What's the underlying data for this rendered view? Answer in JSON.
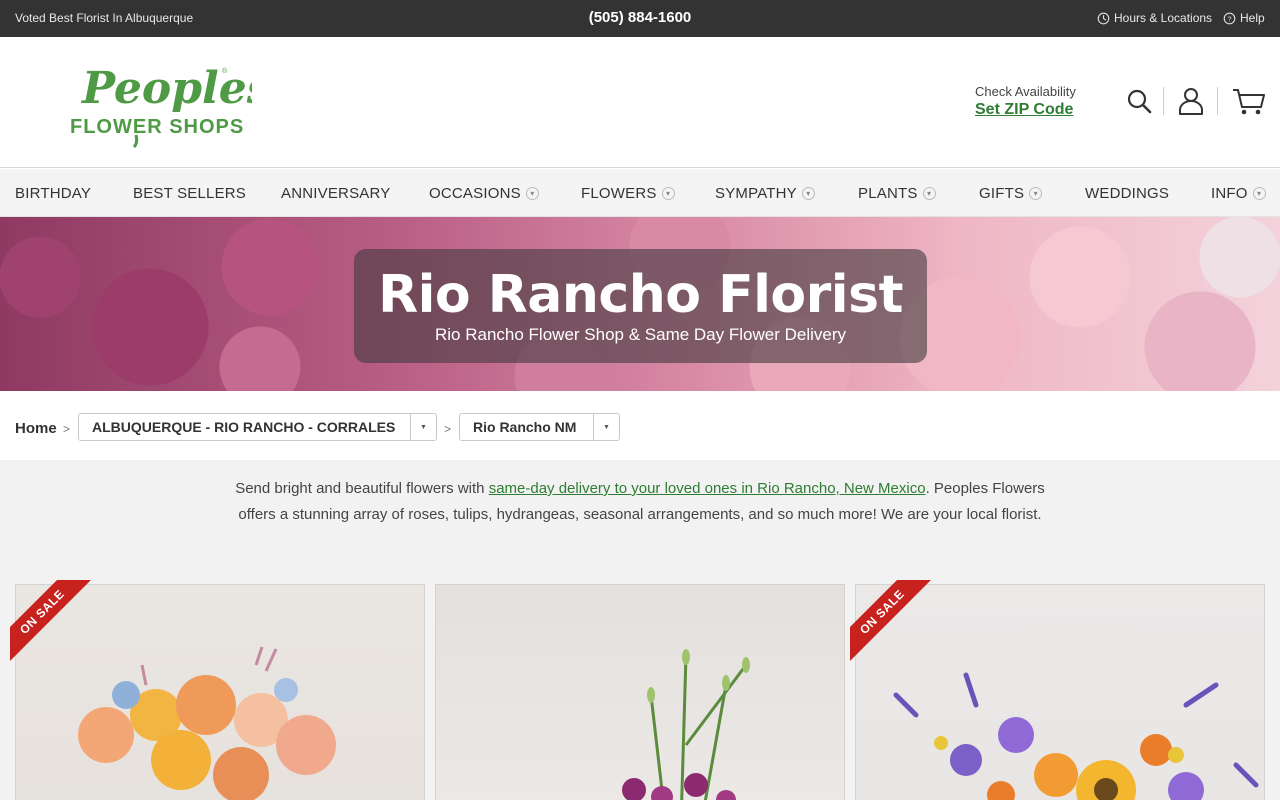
{
  "topbar": {
    "tagline": "Voted Best Florist In Albuquerque",
    "phone": "(505) 884-1600",
    "hours_label": "Hours & Locations",
    "help_label": "Help"
  },
  "header": {
    "logo_text_top": "Peoples",
    "logo_text_bottom": "FLOWER SHOPS",
    "zip_label": "Check Availability",
    "zip_link": "Set ZIP Code"
  },
  "nav": {
    "items": [
      {
        "label": "BIRTHDAY"
      },
      {
        "label": "BEST SELLERS"
      },
      {
        "label": "ANNIVERSARY"
      },
      {
        "label": "OCCASIONS"
      },
      {
        "label": "FLOWERS"
      },
      {
        "label": "SYMPATHY"
      },
      {
        "label": "PLANTS"
      },
      {
        "label": "GIFTS"
      },
      {
        "label": "WEDDINGS"
      },
      {
        "label": "INFO"
      }
    ]
  },
  "hero": {
    "title": "Rio Rancho Florist",
    "subtitle": "Rio Rancho Flower Shop & Same Day Flower Delivery"
  },
  "breadcrumb": {
    "home": "Home",
    "separator": ">",
    "region": "ALBUQUERQUE - RIO RANCHO - CORRALES",
    "city": "Rio Rancho NM"
  },
  "intro": {
    "before_link": "Send bright and beautiful flowers with ",
    "link": "same-day delivery to your loved ones in Rio Rancho, New Mexico",
    "after_link": ". Peoples Flowers offers a stunning array of roses, tulips, hydrangeas, seasonal arrangements, and so much more! We are your local florist."
  },
  "products": [
    {
      "badge": "ON SALE"
    },
    {
      "badge": ""
    },
    {
      "badge": "ON SALE"
    }
  ],
  "colors": {
    "topbar": "#333333",
    "brand_green": "#2e7d32",
    "sale_red": "#c8221e"
  }
}
